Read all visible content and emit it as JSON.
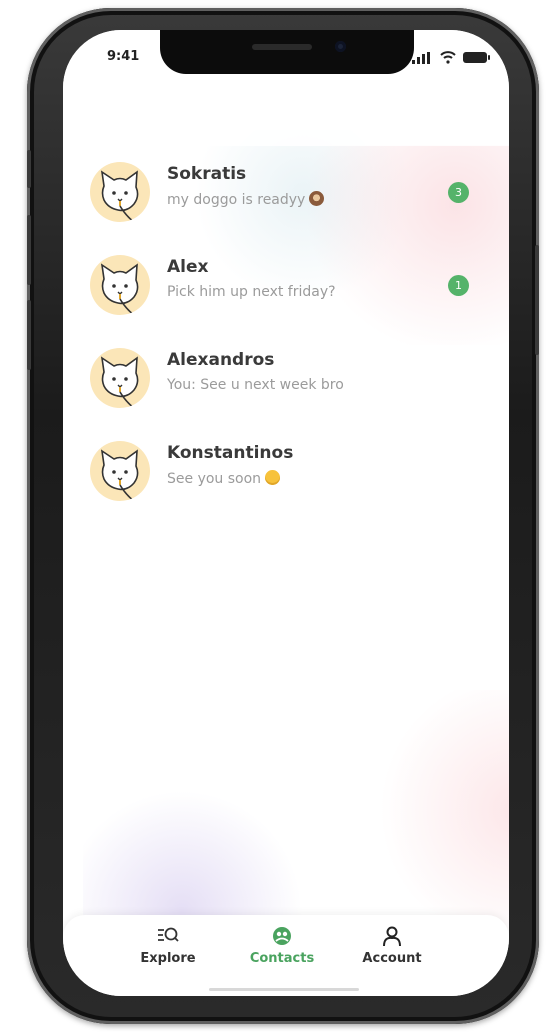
{
  "status_bar": {
    "time": "9:41"
  },
  "contacts": [
    {
      "name": "Sokratis",
      "message": "my doggo is readyy",
      "emoji": "see-no-evil-monkey-emoji",
      "unread": "3"
    },
    {
      "name": "Alex",
      "message": "Pick him up next friday?",
      "unread": "1"
    },
    {
      "name": "Alexandros",
      "message": "You: See u next week bro"
    },
    {
      "name": "Konstantinos",
      "message": "See you soon",
      "emoji": "winking-face-emoji"
    }
  ],
  "tabbar": {
    "items": [
      {
        "label": "Explore",
        "icon": "explore-search-icon"
      },
      {
        "label": "Contacts",
        "icon": "contacts-icon",
        "active": true
      },
      {
        "label": "Account",
        "icon": "user-icon"
      }
    ]
  },
  "colors": {
    "accent": "#4aa35f",
    "badge": "#55b36a",
    "avatar_bg": "#fbe6b8"
  }
}
